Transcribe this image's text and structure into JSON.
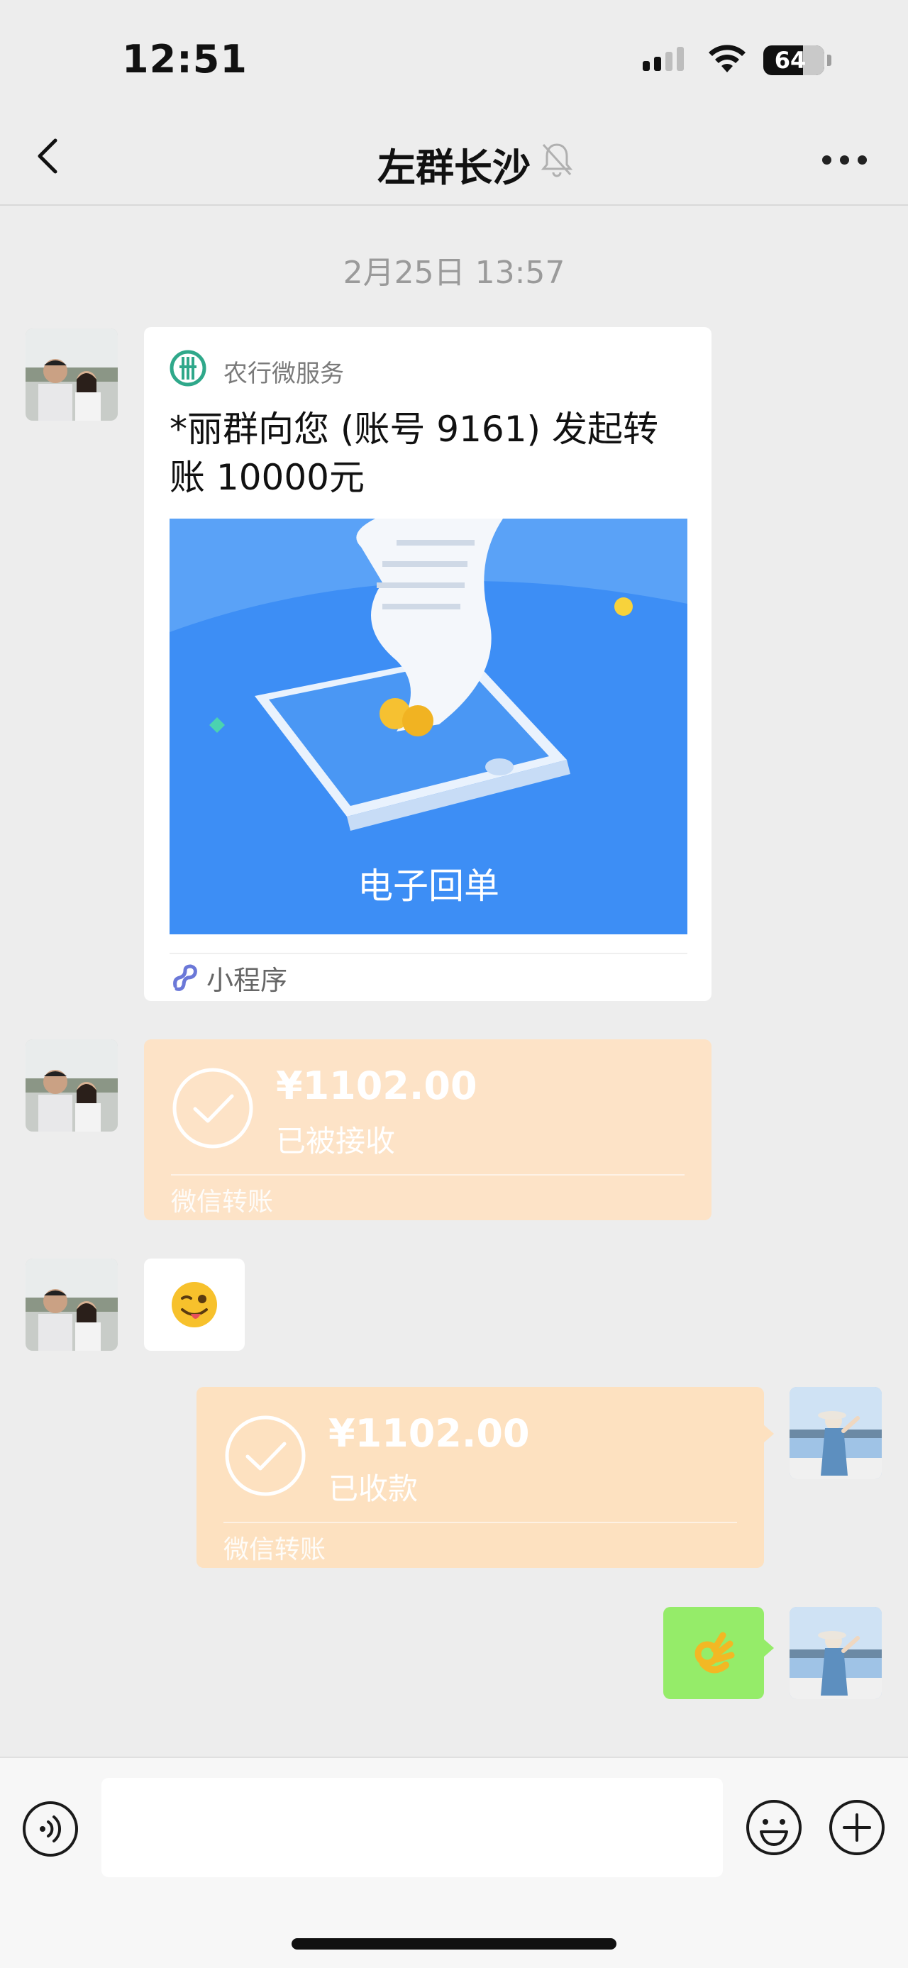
{
  "status_bar": {
    "time": "12:51",
    "battery": "64"
  },
  "nav": {
    "title": "左群长沙"
  },
  "chat": {
    "timestamp": "2月25日 13:57",
    "mini_program": {
      "source": "农行微服务",
      "title": "*丽群向您 (账号 9161) 发起转账 10000元",
      "image_caption": "电子回单",
      "footer": "小程序"
    },
    "transfer_received": {
      "amount": "¥1102.00",
      "state": "已被接收",
      "brand": "微信转账"
    },
    "transfer_sent": {
      "amount": "¥1102.00",
      "state": "已收款",
      "brand": "微信转账"
    },
    "emoji_in": "😜",
    "emoji_out": "👌"
  },
  "input": {
    "value": ""
  },
  "colors": {
    "background": "#ededed",
    "transfer_bubble": "#fde1c0",
    "sent_bubble": "#95ec69",
    "mini_program_image": "#3d8ef5",
    "abc_logo": "#2fa88a"
  }
}
